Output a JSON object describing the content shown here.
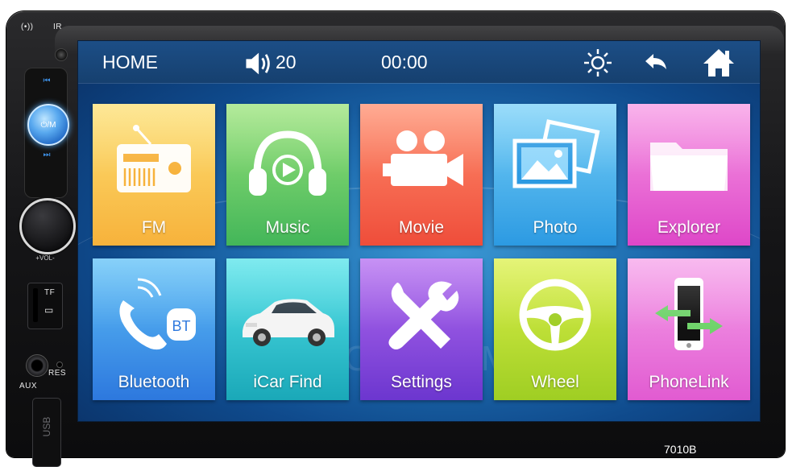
{
  "device": {
    "model": "7010B",
    "labels": {
      "mic": "(•))",
      "ir": "IR",
      "prev": "⏮",
      "power": "⏻/M",
      "next": "⏭",
      "vol": "+VOL-",
      "tf": "TF",
      "aux": "AUX",
      "res": "RES",
      "usb": "USB"
    }
  },
  "statusbar": {
    "home_label": "HOME",
    "volume_value": "20",
    "clock": "00:00",
    "icons": [
      "volume-icon",
      "brightness-icon",
      "back-icon",
      "home-icon"
    ]
  },
  "apps": [
    {
      "label": "FM",
      "icon": "radio-icon",
      "color": "#f7b23b"
    },
    {
      "label": "Music",
      "icon": "headphones-icon",
      "color": "#43b659"
    },
    {
      "label": "Movie",
      "icon": "video-camera-icon",
      "color": "#ef4d3a"
    },
    {
      "label": "Photo",
      "icon": "photo-icon",
      "color": "#2c9ae2"
    },
    {
      "label": "Explorer",
      "icon": "folder-icon",
      "color": "#de47c8"
    },
    {
      "label": "Bluetooth",
      "icon": "bluetooth-phone-icon",
      "badge": "BT",
      "color": "#2d78de"
    },
    {
      "label": "iCar Find",
      "icon": "car-icon",
      "color": "#1aa8b8"
    },
    {
      "label": "Settings",
      "icon": "tools-icon",
      "color": "#6c36cf"
    },
    {
      "label": "Wheel",
      "icon": "steering-wheel-icon",
      "color": "#9fce23"
    },
    {
      "label": "PhoneLink",
      "icon": "phone-link-icon",
      "color": "#e15bd1"
    }
  ]
}
